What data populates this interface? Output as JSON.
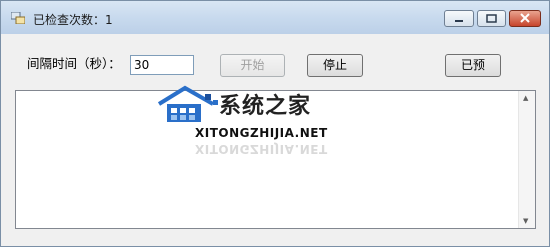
{
  "window": {
    "title": "已检查次数：1",
    "controls": {
      "minimize": "minimize-icon",
      "maximize": "maximize-icon",
      "close": "close-icon"
    }
  },
  "form": {
    "interval_label": "间隔时间（秒）：",
    "interval_value": "30",
    "start_label": "开始",
    "stop_label": "停止",
    "done_label": "已预"
  },
  "watermark": {
    "cn": "系统之家",
    "en": "XITONGZHIJIA.NET",
    "colors": {
      "logo_blue": "#2a6fc9",
      "logo_dark": "#1b4f9c"
    }
  },
  "log": {
    "content": ""
  }
}
